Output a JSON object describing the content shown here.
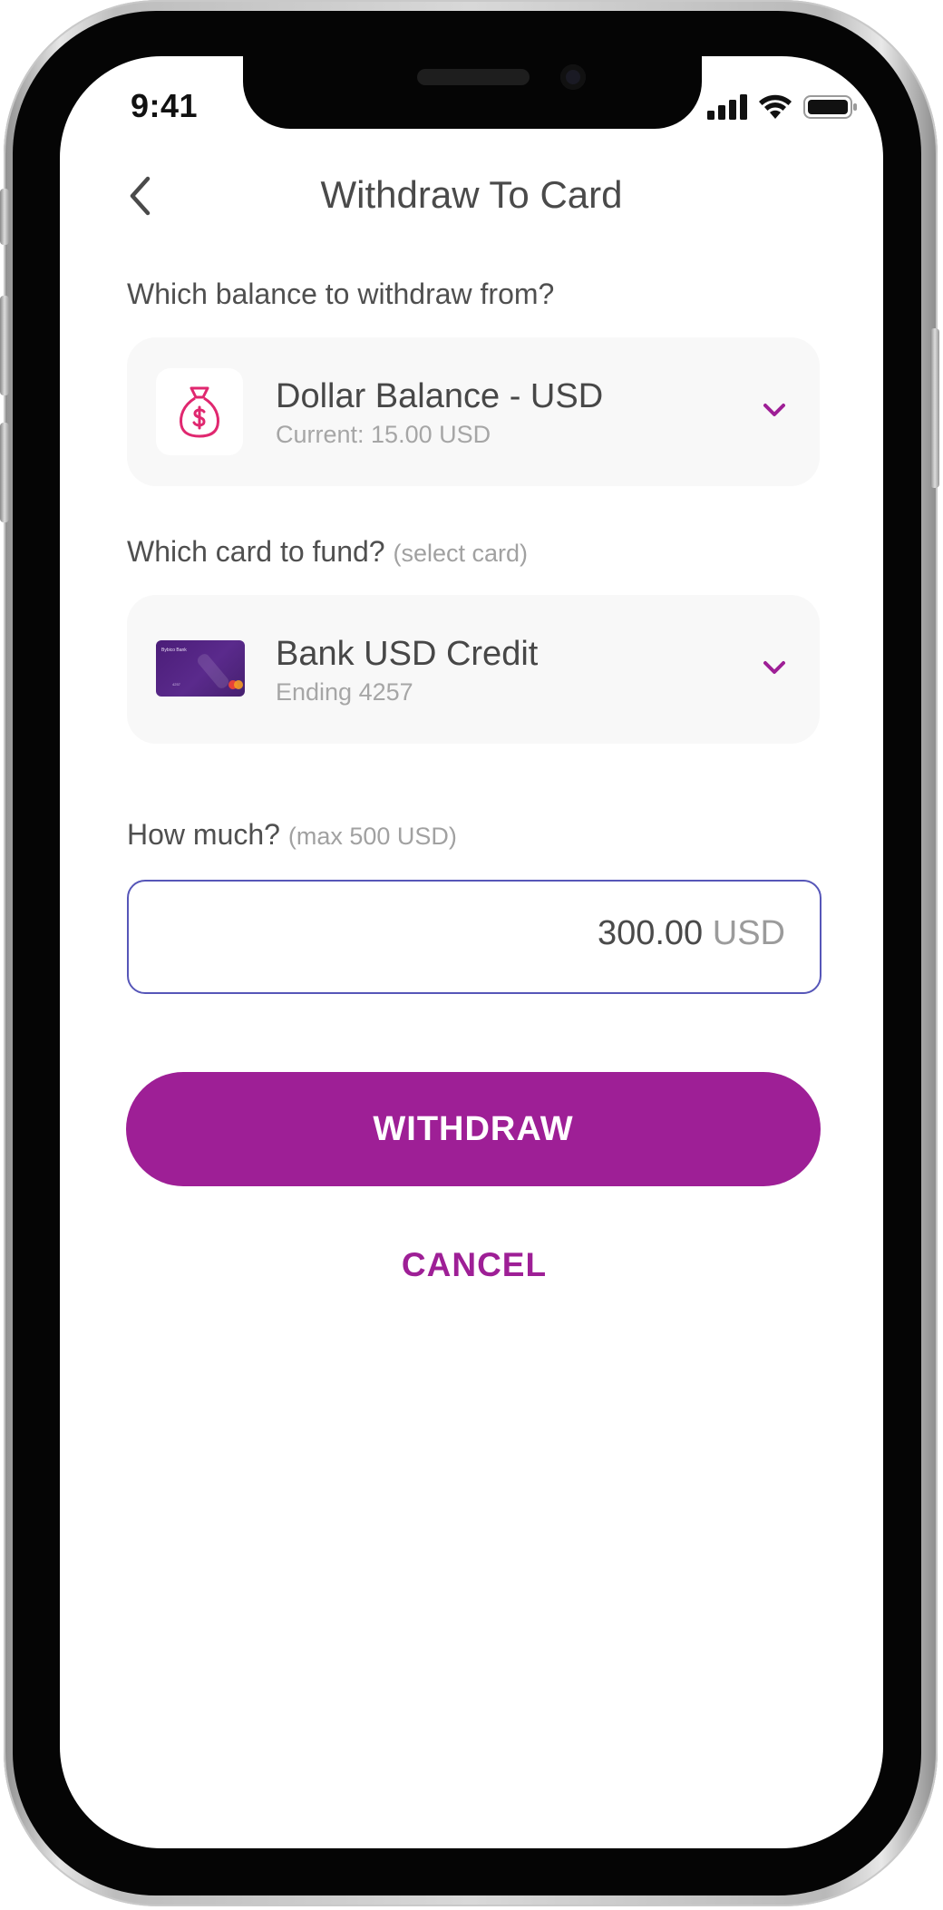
{
  "status_bar": {
    "time": "9:41",
    "signal_icon": "cellular-signal-icon",
    "wifi_icon": "wifi-icon",
    "battery_icon": "battery-icon"
  },
  "header": {
    "back_icon": "chevron-left-icon",
    "title": "Withdraw To Card"
  },
  "balance_section": {
    "label": "Which balance to withdraw from?",
    "selected": {
      "icon": "money-bag-icon",
      "title": "Dollar Balance - USD",
      "subtitle": "Current: 15.00 USD"
    },
    "chevron_icon": "chevron-down-icon"
  },
  "card_section": {
    "label": "Which card to fund?",
    "hint": "(select card)",
    "selected": {
      "card_brand_text": "Bybico Bank",
      "card_number_text": "4257",
      "title": "Bank USD Credit",
      "subtitle": "Ending 4257"
    },
    "chevron_icon": "chevron-down-icon"
  },
  "amount_section": {
    "label": "How much?",
    "hint": "(max 500 USD)",
    "value": "300.00",
    "currency": "USD"
  },
  "actions": {
    "primary": "WITHDRAW",
    "secondary": "CANCEL"
  },
  "colors": {
    "accent": "#9e1f96",
    "input_border": "#5656b8",
    "selector_bg": "#f8f8f8",
    "icon_pink": "#e0276f"
  }
}
